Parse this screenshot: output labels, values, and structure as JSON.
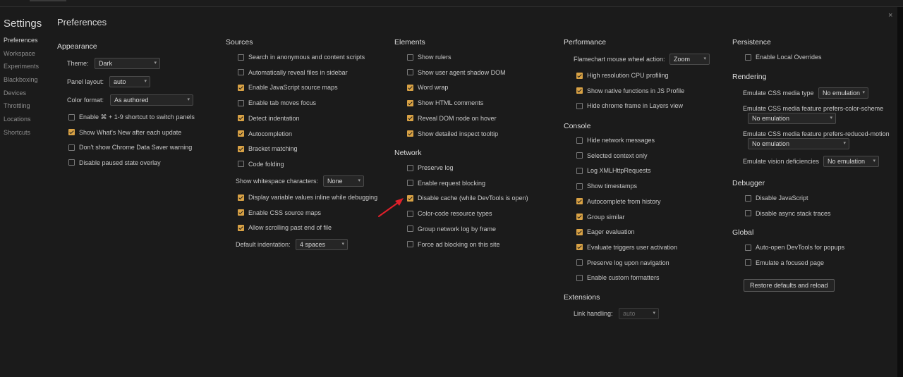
{
  "window": {
    "close_glyph": "×"
  },
  "sidebar": {
    "title": "Settings",
    "items": [
      "Preferences",
      "Workspace",
      "Experiments",
      "Blackboxing",
      "Devices",
      "Throttling",
      "Locations",
      "Shortcuts"
    ]
  },
  "content": {
    "title": "Preferences"
  },
  "appearance": {
    "title": "Appearance",
    "theme_label": "Theme:",
    "theme_value": "Dark",
    "panel_layout_label": "Panel layout:",
    "panel_layout_value": "auto",
    "color_format_label": "Color format:",
    "color_format_value": "As authored",
    "options": [
      {
        "label": "Enable ⌘ + 1-9 shortcut to switch panels",
        "checked": false
      },
      {
        "label": "Show What's New after each update",
        "checked": true
      },
      {
        "label": "Don't show Chrome Data Saver warning",
        "checked": false
      },
      {
        "label": "Disable paused state overlay",
        "checked": false
      }
    ]
  },
  "sources": {
    "title": "Sources",
    "options_a": [
      {
        "label": "Search in anonymous and content scripts",
        "checked": false
      },
      {
        "label": "Automatically reveal files in sidebar",
        "checked": false
      },
      {
        "label": "Enable JavaScript source maps",
        "checked": true
      },
      {
        "label": "Enable tab moves focus",
        "checked": false
      },
      {
        "label": "Detect indentation",
        "checked": true
      },
      {
        "label": "Autocompletion",
        "checked": true
      },
      {
        "label": "Bracket matching",
        "checked": true
      },
      {
        "label": "Code folding",
        "checked": false
      }
    ],
    "whitespace_label": "Show whitespace characters:",
    "whitespace_value": "None",
    "options_b": [
      {
        "label": "Display variable values inline while debugging",
        "checked": true
      },
      {
        "label": "Enable CSS source maps",
        "checked": true
      },
      {
        "label": "Allow scrolling past end of file",
        "checked": true
      }
    ],
    "indent_label": "Default indentation:",
    "indent_value": "4 spaces"
  },
  "elements": {
    "title": "Elements",
    "options": [
      {
        "label": "Show rulers",
        "checked": false
      },
      {
        "label": "Show user agent shadow DOM",
        "checked": false
      },
      {
        "label": "Word wrap",
        "checked": true
      },
      {
        "label": "Show HTML comments",
        "checked": true
      },
      {
        "label": "Reveal DOM node on hover",
        "checked": true
      },
      {
        "label": "Show detailed inspect tooltip",
        "checked": true
      }
    ]
  },
  "network": {
    "title": "Network",
    "options": [
      {
        "label": "Preserve log",
        "checked": false
      },
      {
        "label": "Enable request blocking",
        "checked": false
      },
      {
        "label": "Disable cache (while DevTools is open)",
        "checked": true
      },
      {
        "label": "Color-code resource types",
        "checked": false
      },
      {
        "label": "Group network log by frame",
        "checked": false
      },
      {
        "label": "Force ad blocking on this site",
        "checked": false
      }
    ]
  },
  "performance": {
    "title": "Performance",
    "wheel_label": "Flamechart mouse wheel action:",
    "wheel_value": "Zoom",
    "options": [
      {
        "label": "High resolution CPU profiling",
        "checked": true
      },
      {
        "label": "Show native functions in JS Profile",
        "checked": true
      },
      {
        "label": "Hide chrome frame in Layers view",
        "checked": false
      }
    ]
  },
  "console": {
    "title": "Console",
    "options": [
      {
        "label": "Hide network messages",
        "checked": false
      },
      {
        "label": "Selected context only",
        "checked": false
      },
      {
        "label": "Log XMLHttpRequests",
        "checked": false
      },
      {
        "label": "Show timestamps",
        "checked": false
      },
      {
        "label": "Autocomplete from history",
        "checked": true
      },
      {
        "label": "Group similar",
        "checked": true
      },
      {
        "label": "Eager evaluation",
        "checked": true
      },
      {
        "label": "Evaluate triggers user activation",
        "checked": true
      },
      {
        "label": "Preserve log upon navigation",
        "checked": false
      },
      {
        "label": "Enable custom formatters",
        "checked": false
      }
    ]
  },
  "extensions": {
    "title": "Extensions",
    "link_label": "Link handling:",
    "link_value": "auto"
  },
  "persistence": {
    "title": "Persistence",
    "options": [
      {
        "label": "Enable Local Overrides",
        "checked": false
      }
    ]
  },
  "rendering": {
    "title": "Rendering",
    "media_type_label": "Emulate CSS media type",
    "media_type_value": "No emulation",
    "color_scheme_label": "Emulate CSS media feature prefers-color-scheme",
    "color_scheme_value": "No emulation",
    "reduced_motion_label": "Emulate CSS media feature prefers-reduced-motion",
    "reduced_motion_value": "No emulation",
    "vision_label": "Emulate vision deficiencies",
    "vision_value": "No emulation"
  },
  "debugger": {
    "title": "Debugger",
    "options": [
      {
        "label": "Disable JavaScript",
        "checked": false
      },
      {
        "label": "Disable async stack traces",
        "checked": false
      }
    ]
  },
  "global": {
    "title": "Global",
    "options": [
      {
        "label": "Auto-open DevTools for popups",
        "checked": false
      },
      {
        "label": "Emulate a focused page",
        "checked": false
      }
    ],
    "restore_label": "Restore defaults and reload"
  },
  "colors": {
    "accent": "#d9a245",
    "annotation_arrow": "#e0202a"
  }
}
